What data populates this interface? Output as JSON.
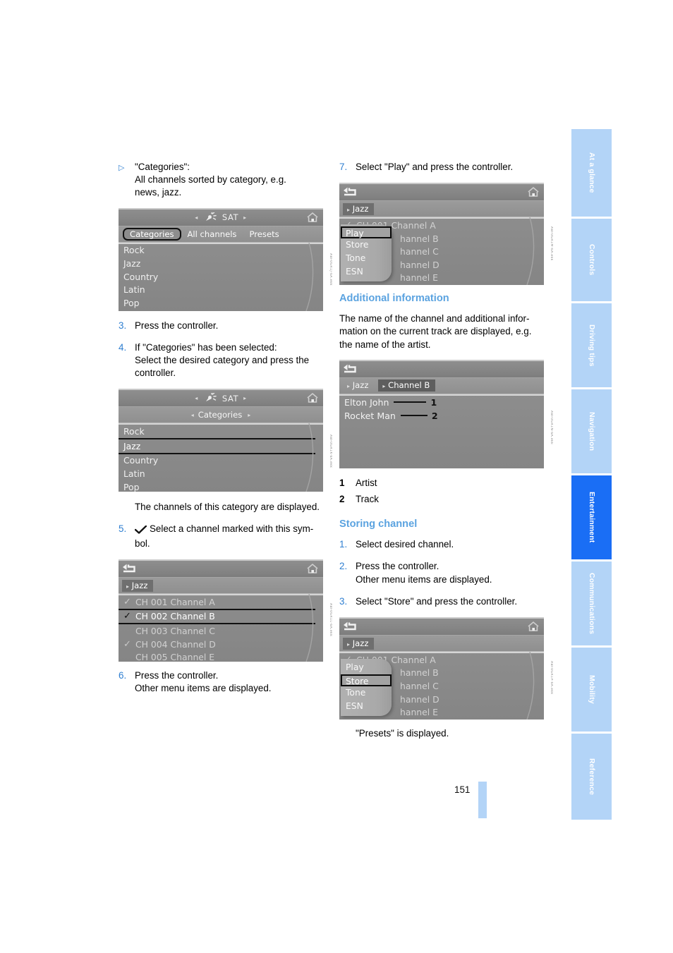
{
  "page": {
    "number": "151",
    "chapter_active": "Entertainment",
    "accent_blue": "#1a6ef5",
    "tab_blue": "#b3d4f7",
    "heading_blue": "#5ba3e0",
    "step_num_blue": "#2f7fd1"
  },
  "sidebar": {
    "chapters": [
      {
        "label": "At a glance",
        "active": false
      },
      {
        "label": "Controls",
        "active": false
      },
      {
        "label": "Driving tips",
        "active": false
      },
      {
        "label": "Navigation",
        "active": false
      },
      {
        "label": "Entertainment",
        "active": true
      },
      {
        "label": "Communications",
        "active": false
      },
      {
        "label": "Mobility",
        "active": false
      },
      {
        "label": "Reference",
        "active": false
      }
    ]
  },
  "left_column": {
    "bullet": {
      "marker": "▷",
      "line1": "\"Categories\":",
      "line2": "All channels sorted by category, e.g.",
      "line3": "news, jazz."
    },
    "shot_categories": {
      "caption": "ABF0GR1J-6A.ekk",
      "title": "SAT",
      "arrow_left": "◂",
      "arrow_right": "▸",
      "home_icon": "home-icon",
      "dish_icon": "satellite-dish-icon",
      "tabs": [
        {
          "label": "Categories",
          "selected": true
        },
        {
          "label": "All channels",
          "selected": false
        },
        {
          "label": "Presets",
          "selected": false
        }
      ],
      "items": [
        "Rock",
        "Jazz",
        "Country",
        "Latin",
        "Pop"
      ]
    },
    "step3": {
      "num": "3.",
      "text": "Press the controller."
    },
    "step4": {
      "num": "4.",
      "line1": "If \"Categories\" has been selected:",
      "line2": "Select the desired category and press the",
      "line3": "controller."
    },
    "shot_jazz_selected": {
      "caption": "ABF0GR1K-6A.ekk",
      "title": "SAT",
      "crumb": "Categories",
      "arrow_left": "◂",
      "arrow_right": "▸",
      "items": [
        {
          "label": "Rock",
          "selected": false
        },
        {
          "label": "Jazz",
          "selected": true
        },
        {
          "label": "Country",
          "selected": false
        },
        {
          "label": "Latin",
          "selected": false
        },
        {
          "label": "Pop",
          "selected": false
        }
      ]
    },
    "note_channels": "The channels of this category are displayed.",
    "step5": {
      "num": "5.",
      "symbol": "✔",
      "line1": "Select a channel marked with this sym-",
      "line2": "bol."
    },
    "shot_channel_list": {
      "caption": "ABF0GR1L-6A.ekk",
      "back_icon": "back-arrow-icon",
      "home_icon": "home-icon",
      "crumb": "Jazz",
      "items": [
        {
          "label": "CH 001 Channel A",
          "checked": true,
          "selected": false
        },
        {
          "label": "CH 002 Channel B",
          "checked": true,
          "selected": true
        },
        {
          "label": "CH 003 Channel C",
          "checked": false,
          "selected": false
        },
        {
          "label": "CH 004 Channel D",
          "checked": true,
          "selected": false
        },
        {
          "label": "CH 005 Channel E",
          "checked": false,
          "selected": false
        }
      ]
    },
    "step6": {
      "num": "6.",
      "line1": "Press the controller.",
      "line2": "Other menu items are displayed."
    }
  },
  "right_column": {
    "step7": {
      "num": "7.",
      "text": "Select \"Play\" and press the controller."
    },
    "shot_play_menu": {
      "caption": "ABF0GR1M-6A.ekk",
      "back_icon": "back-arrow-icon",
      "home_icon": "home-icon",
      "crumb": "Jazz",
      "menu": [
        {
          "label": "Play",
          "selected": true
        },
        {
          "label": "Store",
          "selected": false
        },
        {
          "label": "Tone",
          "selected": false
        },
        {
          "label": "ESN",
          "selected": false
        }
      ],
      "items": [
        {
          "label": "CH 001 Channel A",
          "checked": true
        },
        {
          "label": "hannel B",
          "checked": false
        },
        {
          "label": "hannel C",
          "checked": false
        },
        {
          "label": "hannel D",
          "checked": false
        },
        {
          "label": "hannel E",
          "checked": false
        }
      ]
    },
    "additional_information": {
      "heading": "Additional information",
      "line1": "The name of the channel and additional infor-",
      "line2": "mation on the current track are displayed, e.g.",
      "line3": "the name of the artist."
    },
    "shot_now_playing": {
      "caption": "ABF0GR1N-6A.ekk",
      "back_icon": "back-arrow-icon",
      "crumb1": "Jazz",
      "crumb2": "Channel B",
      "artist": "Elton John",
      "track": "Rocket Man",
      "artist_index": "1",
      "track_index": "2"
    },
    "legend": [
      {
        "num": "1",
        "label": "Artist"
      },
      {
        "num": "2",
        "label": "Track"
      }
    ],
    "storing_channel": {
      "heading": "Storing channel",
      "step1": {
        "num": "1.",
        "text": "Select desired channel."
      },
      "step2": {
        "num": "2.",
        "line1": "Press the controller.",
        "line2": "Other menu items are displayed."
      },
      "step3": {
        "num": "3.",
        "text": "Select \"Store\" and press the controller."
      }
    },
    "shot_store_menu": {
      "caption": "ABF0GR1P-6A.ekk",
      "back_icon": "back-arrow-icon",
      "home_icon": "home-icon",
      "crumb": "Jazz",
      "menu": [
        {
          "label": "Play",
          "selected": false
        },
        {
          "label": "Store",
          "selected": true
        },
        {
          "label": "Tone",
          "selected": false
        },
        {
          "label": "ESN",
          "selected": false
        }
      ],
      "items": [
        {
          "label": "CH 001 Channel A",
          "checked": true
        },
        {
          "label": "hannel B",
          "checked": false
        },
        {
          "label": "hannel C",
          "checked": false
        },
        {
          "label": "hannel D",
          "checked": false
        },
        {
          "label": "hannel E",
          "checked": false
        }
      ]
    },
    "presets_note": "\"Presets\" is displayed."
  }
}
